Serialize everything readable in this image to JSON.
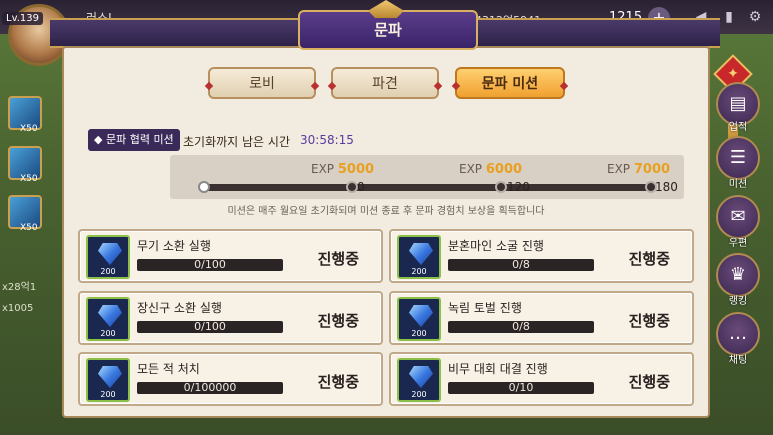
{
  "player": {
    "level": "Lv.139",
    "name": "러스L"
  },
  "currency": {
    "gold": "4312억5941",
    "gems": "1215"
  },
  "window": {
    "title": "문파"
  },
  "tabs": [
    {
      "label": "로비",
      "active": false
    },
    {
      "label": "파견",
      "active": false
    },
    {
      "label": "문파 미션",
      "active": true
    }
  ],
  "mission_info": {
    "tag": "문파 협력 미션",
    "reset_label": "초기화까지 남은 시간",
    "reset_time": "30:58:15",
    "exp_prefix": "EXP",
    "milestones": [
      {
        "exp": "5000",
        "mark": "0"
      },
      {
        "exp": "6000",
        "mark": "120"
      },
      {
        "exp": "7000",
        "mark": "180"
      }
    ],
    "current_progress": 0,
    "note": "미션은 매주 월요일 초기화되며 미션 종료 후 문파 경험치 보상을 획득합니다"
  },
  "missions": [
    {
      "name": "무기 소환 실행",
      "progress": "0/100",
      "reward": "200",
      "status": "진행중"
    },
    {
      "name": "분혼마인 소굴 진행",
      "progress": "0/8",
      "reward": "200",
      "status": "진행중"
    },
    {
      "name": "장신구 소환 실행",
      "progress": "0/100",
      "reward": "200",
      "status": "진행중"
    },
    {
      "name": "녹림 토벌 진행",
      "progress": "0/8",
      "reward": "200",
      "status": "진행중"
    },
    {
      "name": "모든 적 처치",
      "progress": "0/100000",
      "reward": "200",
      "status": "진행중"
    },
    {
      "name": "비무 대회 대결 진행",
      "progress": "0/10",
      "reward": "200",
      "status": "진행중"
    }
  ],
  "left_skills": [
    {
      "count": "X50"
    },
    {
      "count": "X50"
    },
    {
      "count": "X50"
    }
  ],
  "left_stats": [
    "x28억1",
    "x1005"
  ],
  "sidebar": [
    {
      "label": "업적",
      "icon": "clipboard-icon"
    },
    {
      "label": "미션",
      "icon": "mission-icon"
    },
    {
      "label": "우편",
      "icon": "mail-icon"
    },
    {
      "label": "랭킹",
      "icon": "crown-icon"
    },
    {
      "label": "채팅",
      "icon": "chat-icon"
    }
  ],
  "colors": {
    "accent": "#f0a030",
    "title": "#3a2468",
    "exp": "#e8a020",
    "time": "#5a3aa0"
  }
}
